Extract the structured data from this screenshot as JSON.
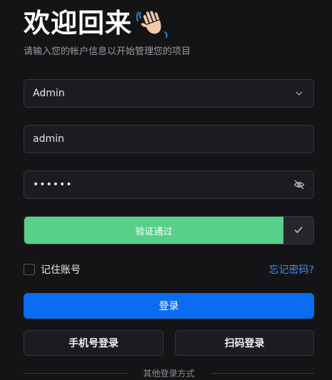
{
  "header": {
    "title": "欢迎回来",
    "subtitle": "请输入您的帐户信息以开始管理您的项目"
  },
  "form": {
    "role_select": {
      "value": "Admin",
      "icon": "chevron-down-icon"
    },
    "username": {
      "value": "admin"
    },
    "password": {
      "masked_value": "••••••",
      "icon": "eye-off-icon"
    },
    "verify": {
      "label": "验证通过",
      "icon": "check-icon"
    },
    "remember_label": "记住账号",
    "forgot_label": "忘记密码?",
    "login_label": "登录",
    "phone_login_label": "手机号登录",
    "qr_login_label": "扫码登录",
    "other_methods_label": "其他登录方式"
  },
  "colors": {
    "background": "#141416",
    "primary": "#0a6cf0",
    "verify_success": "#58d08a",
    "link": "#3f8ef5"
  }
}
